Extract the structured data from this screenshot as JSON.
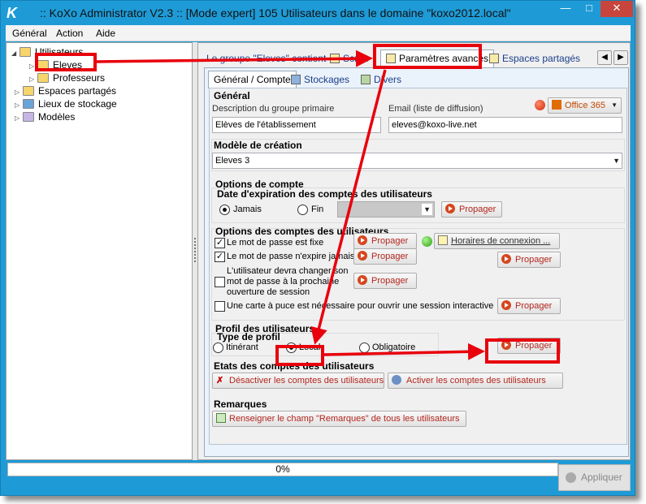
{
  "window": {
    "title": ":: KoXo Administrator V2.3 :: [Mode expert] 105 Utilisateurs dans le domaine \"koxo2012.local\"",
    "minimize": "—",
    "maximize": "□",
    "close": "✕"
  },
  "menu": {
    "items": [
      "Général",
      "Action",
      "Aide"
    ]
  },
  "tree": {
    "root": "Utilisateurs",
    "children": [
      "Eleves",
      "Professeurs"
    ],
    "others": [
      "Espaces partagés",
      "Lieux de stockage",
      "Modèles"
    ]
  },
  "top_tabs": {
    "items": [
      "Le groupe \"Eleves\" contient",
      "Script",
      "Paramètres avancés",
      "Espaces partagés"
    ],
    "prev": "◀",
    "next": "▶"
  },
  "sub_tabs": {
    "items": [
      "Général / Compte",
      "Stockages",
      "Divers"
    ]
  },
  "general": {
    "title": "Général",
    "desc_label": "Description du groupe primaire",
    "desc_value": "Elèves de l'établissement",
    "email_label": "Email (liste de diffusion)",
    "email_value": "eleves@koxo-live.net",
    "office_label": "Office 365"
  },
  "model": {
    "title": "Modèle de création",
    "value": "Eleves 3"
  },
  "account_options": {
    "title": "Options de compte",
    "expiry_title": "Date d'expiration des comptes des utilisateurs",
    "never": "Jamais",
    "end": "Fin",
    "propagate": "Propager"
  },
  "user_options": {
    "title": "Options des comptes des utilisateurs",
    "fixed_pw": "Le mot de passe est fixe",
    "never_expires": "Le mot de passe n'expire jamais",
    "must_change_1": "L'utilisateur devra changer son",
    "must_change_2": "mot de passe à la prochaine",
    "must_change_3": "ouverture de session",
    "smartcard": "Une carte à puce est nécessaire pour ouvrir une session interactive",
    "logon_hours": "Horaires de connexion ...",
    "propagate": "Propager"
  },
  "profile": {
    "title": "Profil des utilisateurs",
    "type_title": "Type de profil",
    "roaming": "Itinérant",
    "local": "Local",
    "mandatory": "Obligatoire",
    "propagate": "Propager"
  },
  "states": {
    "title": "Etats des comptes des utilisateurs",
    "disable": "Désactiver les comptes des utilisateurs",
    "enable": "Activer les comptes des utilisateurs"
  },
  "remarks": {
    "title": "Remarques",
    "fill": "Renseigner le champ \"Remarques\" de tous les utilisateurs"
  },
  "footer": {
    "progress": "0%",
    "apply": "Appliquer"
  },
  "colors": {
    "title_bg": "#1e9bd7",
    "highlight": "#e8000c",
    "propagate_text": "#b3261e"
  }
}
